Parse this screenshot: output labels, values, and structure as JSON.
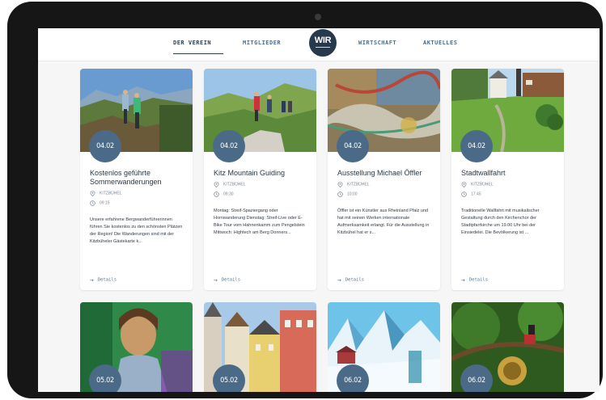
{
  "nav": {
    "items": [
      {
        "label": "DER VEREIN"
      },
      {
        "label": "MITGLIEDER"
      },
      {
        "label": "WIRTSCHAFT"
      },
      {
        "label": "AKTUELLES"
      }
    ],
    "logo_text": "WIR"
  },
  "cards": [
    {
      "date": "04.02",
      "title": "Kostenlos geführte Sommerwanderungen",
      "location": "KITZBÜHEL",
      "time": "09:15",
      "description": "Unsere erfahrene Bergwanderführerinnen führen Sie kostenlos zu den schönsten Plätzen der Region! Die Wanderungen sind mit der Kitzbüheler Gästekarte k...",
      "details_label": "Details"
    },
    {
      "date": "04.02",
      "title": "Kitz Mountain Guiding",
      "location": "KITZBÜHEL",
      "time": "09:30",
      "description": "Montag: Streif-Spaziergang oder Hornwanderung Dienstag: Streif-Live oder E-Bike Tour vom Hahnenkamm zum Pengelstein Mittwoch: Hightech am Berg Donners...",
      "details_label": "Details"
    },
    {
      "date": "04.02",
      "title": "Ausstellung Michael Öffler",
      "location": "KITZBÜHEL",
      "time": "10:00",
      "description": "Öffler ist ein Künstler aus Rheinland Pfalz und hat mit seinen Werken internationale Aufmerksamkeit erlangt. Für die Ausstellung in Kitzbühel hat er s...",
      "details_label": "Details"
    },
    {
      "date": "04.02",
      "title": "Stadtwallfahrt",
      "location": "KITZBÜHEL",
      "time": "17:45",
      "description": "Traditionelle Wallfahrt mit musikalischer Gestaltung durch den Kirchenchor der Stadtpfarrkirche um 19.00 Uhr bei der Einsiedelei. Die Bevölkerung ist ...",
      "details_label": "Details"
    }
  ],
  "cards_row2": [
    {
      "date": "05.02"
    },
    {
      "date": "05.02"
    },
    {
      "date": "06.02"
    },
    {
      "date": "06.02"
    }
  ],
  "colors": {
    "accent": "#4a6a88",
    "logo_bg": "#273a4d",
    "nav_text": "#4c6e8e",
    "device_frame": "#161616"
  },
  "icons": {
    "location": "map-pin-icon",
    "time": "clock-icon",
    "details": "arrow-right-icon"
  }
}
